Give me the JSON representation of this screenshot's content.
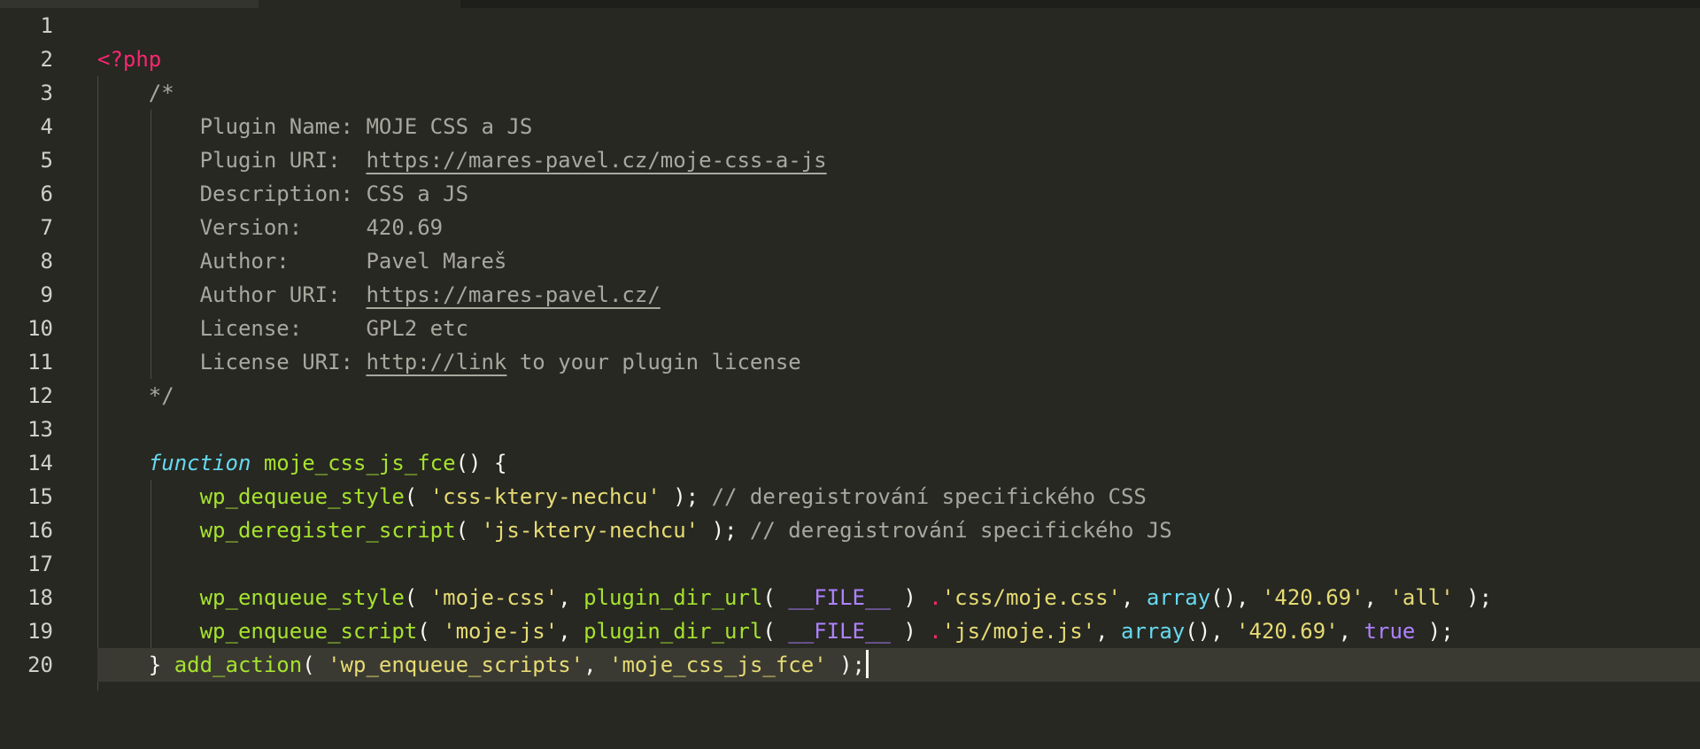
{
  "editor": {
    "lines": [
      {
        "n": "1"
      },
      {
        "n": "2",
        "php_tag": "<?php"
      },
      {
        "n": "3",
        "text": "/*"
      },
      {
        "n": "4",
        "key": "Plugin Name: ",
        "val": "MOJE CSS a JS"
      },
      {
        "n": "5",
        "key": "Plugin URI:  ",
        "url": "https://mares-pavel.cz/moje-css-a-js"
      },
      {
        "n": "6",
        "key": "Description: ",
        "val": "CSS a JS"
      },
      {
        "n": "7",
        "key": "Version:     ",
        "val": "420.69"
      },
      {
        "n": "8",
        "key": "Author:      ",
        "val": "Pavel Mareš"
      },
      {
        "n": "9",
        "key": "Author URI:  ",
        "url": "https://mares-pavel.cz/"
      },
      {
        "n": "10",
        "key": "License:     ",
        "val": "GPL2 etc"
      },
      {
        "n": "11",
        "key": "License URI: ",
        "url": "http://link",
        "rest": " to your plugin license"
      },
      {
        "n": "12",
        "text": "*/"
      },
      {
        "n": "13"
      },
      {
        "n": "14",
        "kw": "function",
        "fname": "moje_css_js_fce",
        "tail": "() {"
      },
      {
        "n": "15",
        "call": "wp_dequeue_style",
        "arg": "'css-ktery-nechcu'",
        "comment": "// deregistrování specifického CSS"
      },
      {
        "n": "16",
        "call": "wp_deregister_script",
        "arg": "'js-ktery-nechcu'",
        "comment": "// deregistrování specifického JS"
      },
      {
        "n": "17"
      },
      {
        "n": "18",
        "call": "wp_enqueue_style",
        "handle": "'moje-css'",
        "dir_fn": "plugin_dir_url",
        "const": "__FILE__",
        "path": "'css/moje.css'",
        "arr": "array",
        "ver": "'420.69'",
        "last": "'all'"
      },
      {
        "n": "19",
        "call": "wp_enqueue_script",
        "handle": "'moje-js'",
        "dir_fn": "plugin_dir_url",
        "const": "__FILE__",
        "path": "'js/moje.js'",
        "arr": "array",
        "ver": "'420.69'",
        "last_const": "true"
      },
      {
        "n": "20",
        "brace": "} ",
        "call": "add_action",
        "hook": "'wp_enqueue_scripts'",
        "cb": "'moje_css_js_fce'"
      }
    ],
    "colors": {
      "background": "#272822",
      "keyword": "#f92672",
      "function": "#a6e22e",
      "string": "#e6db74",
      "storage": "#66d9ef",
      "constant": "#ae81ff",
      "comment": "#a8a89e"
    }
  }
}
